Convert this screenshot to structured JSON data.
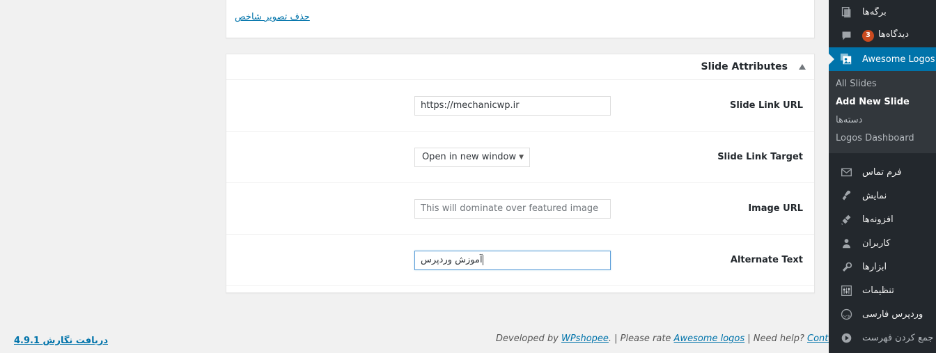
{
  "sidebar": {
    "items": [
      {
        "label": "برگه‌ها",
        "icon": "pages-icon",
        "state": "normal"
      },
      {
        "label": "دیدگاه‌ها",
        "icon": "comments-icon",
        "state": "normal",
        "badge": "3"
      },
      {
        "label": "Awesome Logos",
        "icon": "logos-icon",
        "state": "current"
      },
      {
        "label": "فرم تماس",
        "icon": "mail-icon",
        "state": "normal"
      },
      {
        "label": "نمایش",
        "icon": "appearance-brush-icon",
        "state": "normal"
      },
      {
        "label": "افزونه‌ها",
        "icon": "plugins-plug-icon",
        "state": "normal"
      },
      {
        "label": "کاربران",
        "icon": "users-icon",
        "state": "normal"
      },
      {
        "label": "ابزارها",
        "icon": "tools-wrench-icon",
        "state": "normal"
      },
      {
        "label": "تنظیمات",
        "icon": "settings-sliders-icon",
        "state": "normal"
      },
      {
        "label": "وردپرس فارسی",
        "icon": "wp-farsi-icon",
        "state": "normal"
      },
      {
        "label": "جمع کردن فهرست",
        "icon": "collapse-icon",
        "state": "dim"
      }
    ],
    "submenu": [
      {
        "label": "All Slides",
        "state": "normal"
      },
      {
        "label": "Add New Slide",
        "state": "current"
      },
      {
        "label": "دسته‌ها",
        "state": "normal"
      },
      {
        "label": "Logos Dashboard",
        "state": "normal"
      }
    ],
    "colors": {
      "background": "#23282d",
      "submenu_background": "#32373c",
      "current_background": "#0073aa",
      "badge_background": "#ca4a1f"
    }
  },
  "featured_image_box": {
    "remove_link": "حذف تصویر شاخص"
  },
  "slide_attributes": {
    "title": "Slide Attributes",
    "toggle_icon": "triangle-up-icon",
    "rows": [
      {
        "label": "Slide Link URL",
        "field_type": "text",
        "value": "https://mechanicwp.ir",
        "placeholder": "",
        "focused": false
      },
      {
        "label": "Slide Link Target",
        "field_type": "select",
        "value": "Open in new window",
        "placeholder": "",
        "focused": false
      },
      {
        "label": "Image URL",
        "field_type": "text",
        "value": "",
        "placeholder": "This will dominate over featured image",
        "focused": false
      },
      {
        "label": "Alternate Text",
        "field_type": "text",
        "value": "آموزش وردپرس",
        "placeholder": "",
        "focused": true
      }
    ]
  },
  "footer": {
    "version_link": "دریافت نگارش 4.9.1",
    "credits": {
      "developed_by_prefix": "Developed by ",
      "developer_link": "WPshopee",
      "after_developer": ". | Please rate ",
      "plugin_link": "Awesome logos",
      "after_plugin": " | Need help? ",
      "contact_link": "Contact us"
    }
  },
  "colors": {
    "page_background": "#f1f1f1",
    "link": "#0073aa",
    "panel_background": "#ffffff",
    "panel_border": "#e5e5e5",
    "focus_border": "#5b9dd9"
  }
}
